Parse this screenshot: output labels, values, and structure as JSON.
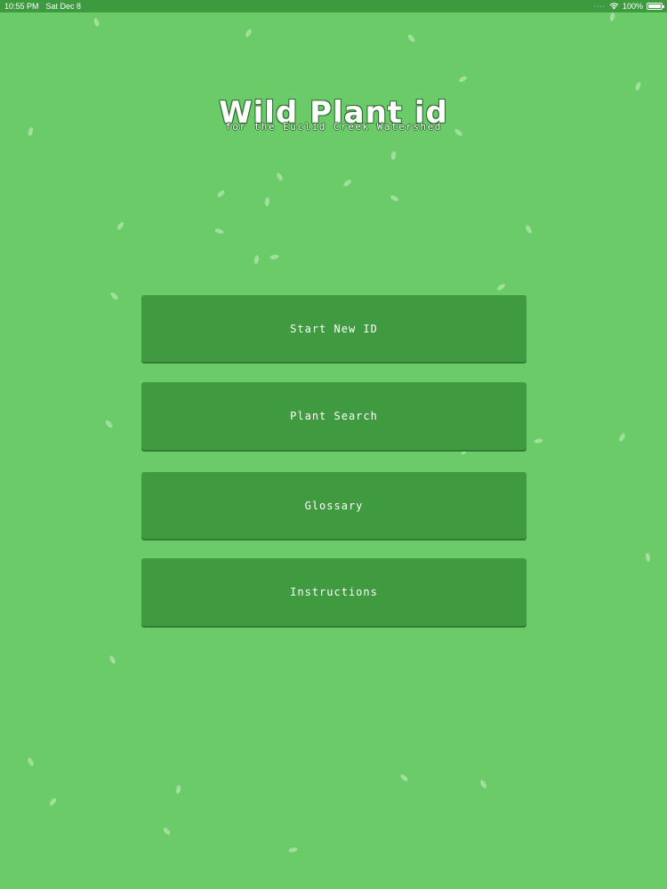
{
  "status_bar": {
    "time": "10:55 PM",
    "date": "Sat Dec 8",
    "battery_text": "100%",
    "battery_level": 1.0,
    "wifi_icon": "wifi-icon",
    "battery_icon": "battery-icon"
  },
  "header": {
    "title": "Wild Plant id",
    "subtitle": "for the Euclid Creek Watershed"
  },
  "menu": {
    "buttons": [
      {
        "label": "Start New ID"
      },
      {
        "label": "Plant Search"
      },
      {
        "label": "Glossary"
      },
      {
        "label": "Instructions"
      }
    ]
  },
  "colors": {
    "background": "#6acb68",
    "button": "#3f9a40",
    "status_bar": "#3e9a3f",
    "leaf": "#a9e4a6",
    "text": "#ffffff"
  }
}
